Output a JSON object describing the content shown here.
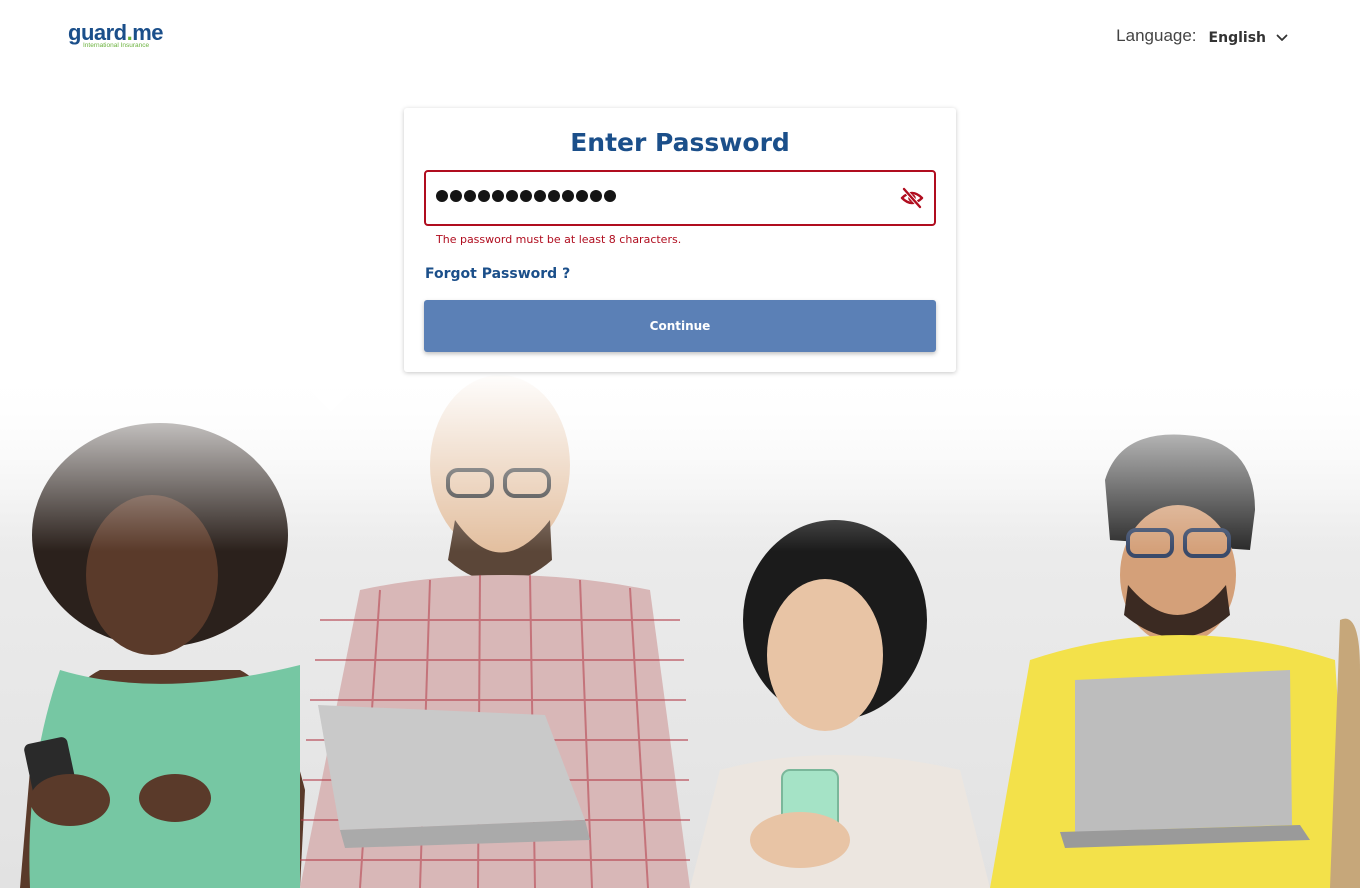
{
  "header": {
    "logo": {
      "text_main": "guard.me",
      "text_sub": "International Insurance",
      "color_main": "#1b4f8a",
      "color_sub": "#6cb33f"
    },
    "language": {
      "label": "Language:",
      "selected": "English",
      "icon": "chevron-down-icon"
    }
  },
  "card": {
    "title": "Enter Password",
    "password_field": {
      "masked_length": 13,
      "toggle_icon": "eye-off-icon"
    },
    "error": "The password must be at least 8 characters.",
    "forgot_link": "Forgot Password ?",
    "continue_button": "Continue"
  },
  "colors": {
    "brand": "#1b4f8a",
    "error": "#b00d1f",
    "button": "#5b80b6",
    "accent_green": "#6cb33f"
  }
}
